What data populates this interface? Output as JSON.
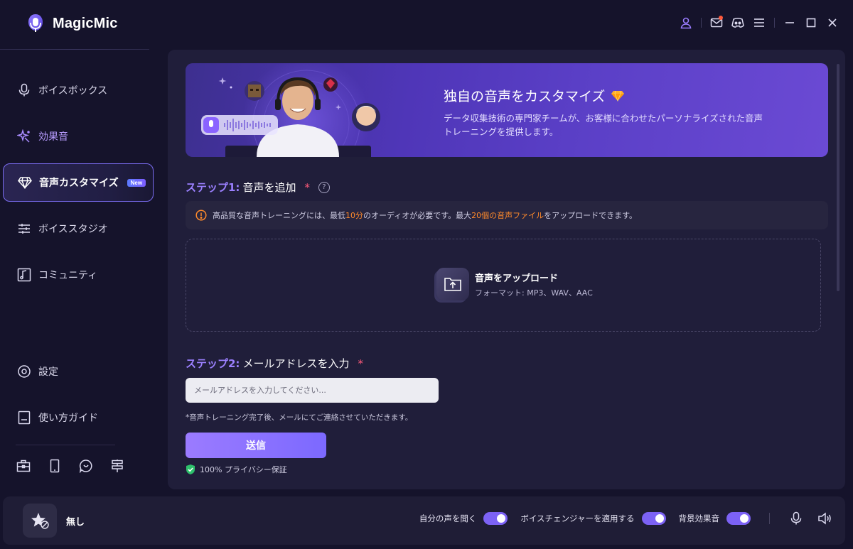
{
  "app": {
    "name": "MagicMic"
  },
  "topbar": {
    "icons": [
      "user-icon",
      "mail-icon",
      "discord-icon",
      "menu-icon",
      "minimize-icon",
      "maximize-icon",
      "close-icon"
    ]
  },
  "sidebar": {
    "items": [
      {
        "label": "ボイスボックス",
        "icon": "microphone-icon"
      },
      {
        "label": "効果音",
        "icon": "sparkle-icon"
      },
      {
        "label": "音声カスタマイズ",
        "icon": "diamond-icon",
        "badge": "New"
      },
      {
        "label": "ボイススタジオ",
        "icon": "sliders-icon"
      },
      {
        "label": "コミュニティ",
        "icon": "music-note-icon"
      },
      {
        "label": "設定",
        "icon": "gear-icon"
      },
      {
        "label": "使い方ガイド",
        "icon": "book-icon"
      }
    ],
    "bottom_icons": [
      "toolbox-icon",
      "mobile-icon",
      "chat-icon",
      "signpost-icon"
    ]
  },
  "banner": {
    "title": "独自の音声をカスタマイズ",
    "description": "データ収集技術の専門家チームが、お客様に合わせたパーソナライズされた音声トレーニングを提供します。"
  },
  "step1": {
    "prefix": "ステップ1:",
    "title": "音声を追加",
    "required": "*",
    "notice": {
      "part1": "高品質な音声トレーニングには、最低",
      "hl1": "10分",
      "part2": "のオーディオが必要です。最大",
      "hl2": "20個の音声ファイル",
      "part3": "をアップロードできます。"
    },
    "upload_label": "音声をアップロード",
    "upload_format": "フォーマット: MP3、WAV、AAC"
  },
  "step2": {
    "prefix": "ステップ2:",
    "title": "メールアドレスを入力",
    "required": "*",
    "email_placeholder": "メールアドレスを入力してください...",
    "note": "*音声トレーニング完了後、メールにてご連絡させていただきます。",
    "submit_label": "送信",
    "privacy": "100% プライバシー保証"
  },
  "bottombar": {
    "effect_label": "無し",
    "toggles": [
      {
        "label": "自分の声を聞く",
        "on": true
      },
      {
        "label": "ボイスチェンジャーを適用する",
        "on": true
      },
      {
        "label": "背景効果音",
        "on": true
      }
    ]
  },
  "colors": {
    "accent": "#7c62f5",
    "highlight": "#ff8a2b",
    "background": "#15132b",
    "panel": "#201e3a"
  }
}
